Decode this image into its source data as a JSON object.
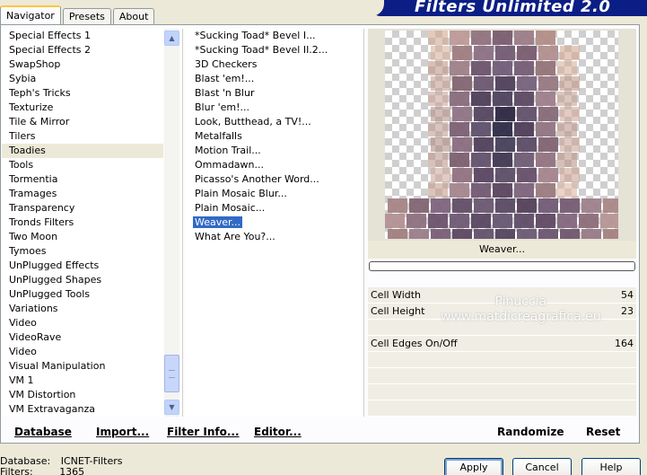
{
  "app": {
    "title": "Filters Unlimited 2.0"
  },
  "tabs": [
    {
      "label": "Navigator",
      "active": true
    },
    {
      "label": "Presets",
      "active": false
    },
    {
      "label": "About",
      "active": false
    }
  ],
  "categories": {
    "selected": "Toadies",
    "items": [
      "Special Effects 1",
      "Special Effects 2",
      "SwapShop",
      "Sybia",
      "Teph's Tricks",
      "Texturize",
      "Tile & Mirror",
      "Tilers",
      "Toadies",
      "Tools",
      "Tormentia",
      "Tramages",
      "Transparency",
      "Tronds Filters",
      "Two Moon",
      "Tymoes",
      "UnPlugged Effects",
      "UnPlugged Shapes",
      "UnPlugged Tools",
      "Variations",
      "Video",
      "VideoRave",
      "Video",
      "Visual Manipulation",
      "VM 1",
      "VM Distortion",
      "VM Extravaganza"
    ]
  },
  "filters": {
    "selected": "Weaver...",
    "items": [
      "*Sucking Toad*  Bevel I...",
      "*Sucking Toad*  Bevel II.2...",
      "3D Checkers",
      "Blast 'em!...",
      "Blast 'n Blur",
      "Blur 'em!...",
      "Look, Butthead, a TV!...",
      "Metalfalls",
      "Motion Trail...",
      "Ommadawn...",
      "Picasso's Another Word...",
      "Plain Mosaic Blur...",
      "Plain Mosaic...",
      "Weaver...",
      "What Are You?..."
    ]
  },
  "preview": {
    "filter_name": "Weaver..."
  },
  "params": [
    {
      "label": "Cell Width",
      "value": "54",
      "level": 0.212
    },
    {
      "label": "Cell Height",
      "value": "23",
      "level": 0.09
    },
    {
      "label": "",
      "value": "",
      "level": null
    },
    {
      "label": "Cell Edges On/Off",
      "value": "164",
      "level": 0.643
    },
    {
      "label": "",
      "value": "",
      "level": null
    },
    {
      "label": "",
      "value": "",
      "level": null
    },
    {
      "label": "",
      "value": "",
      "level": null
    },
    {
      "label": "",
      "value": "",
      "level": null
    }
  ],
  "watermark": {
    "line1": "Pinuccia",
    "line2": "www.matdicreagrafica.eu"
  },
  "links": {
    "database": "Database",
    "import": "Import...",
    "filter_info": "Filter Info...",
    "editor": "Editor...",
    "randomize": "Randomize",
    "reset": "Reset"
  },
  "status": {
    "database_label": "Database:",
    "database_value": "ICNET-Filters",
    "filters_label": "Filters:",
    "filters_value": "1365"
  },
  "buttons": {
    "apply": "Apply",
    "cancel": "Cancel",
    "help": "Help"
  }
}
